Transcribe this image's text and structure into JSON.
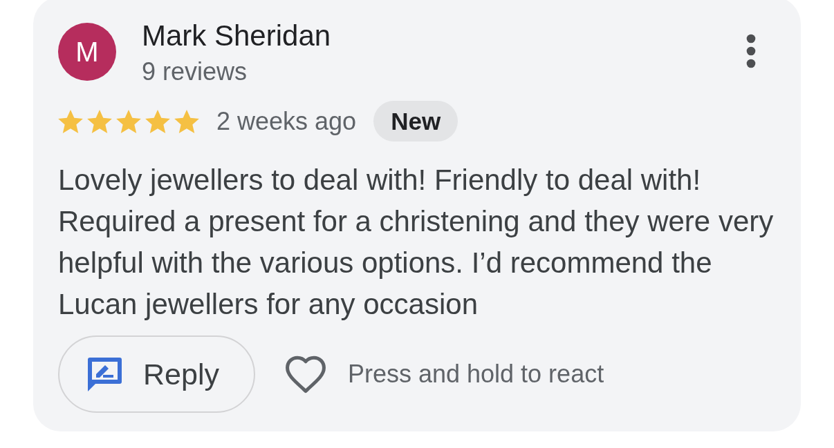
{
  "review": {
    "avatar": {
      "initial": "M"
    },
    "author": "Mark Sheridan",
    "review_count": "9 reviews",
    "stars": 5,
    "time": "2 weeks ago",
    "badge": "New",
    "text": "Lovely jewellers to deal with! Friendly to deal with! Required a present for a christening and they were very helpful with the various options. I’d recommend the Lucan jewellers for any occasion",
    "reply_button": "Reply",
    "liked": false,
    "react_hint": "Press and hold to react"
  }
}
